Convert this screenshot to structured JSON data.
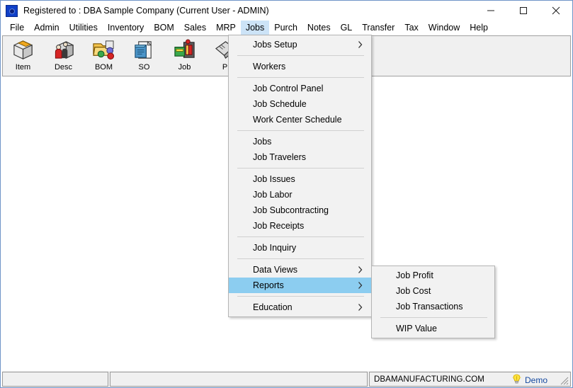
{
  "window": {
    "title": "Registered to : DBA Sample Company (Current User - ADMIN)",
    "icon": "app-gear-icon",
    "controls": {
      "minimize": "minimize-icon",
      "maximize": "maximize-icon",
      "close": "close-icon"
    }
  },
  "menubar": {
    "items": [
      {
        "label": "File",
        "active": false
      },
      {
        "label": "Admin",
        "active": false
      },
      {
        "label": "Utilities",
        "active": false
      },
      {
        "label": "Inventory",
        "active": false
      },
      {
        "label": "BOM",
        "active": false
      },
      {
        "label": "Sales",
        "active": false
      },
      {
        "label": "MRP",
        "active": false
      },
      {
        "label": "Jobs",
        "active": true
      },
      {
        "label": "Purch",
        "active": false
      },
      {
        "label": "Notes",
        "active": false
      },
      {
        "label": "GL",
        "active": false
      },
      {
        "label": "Transfer",
        "active": false
      },
      {
        "label": "Tax",
        "active": false
      },
      {
        "label": "Window",
        "active": false
      },
      {
        "label": "Help",
        "active": false
      }
    ]
  },
  "toolbar": {
    "buttons": [
      {
        "label": "Item",
        "icon": "item-box-icon"
      },
      {
        "label": "Desc",
        "icon": "descriptor-people-box-icon"
      },
      {
        "label": "BOM",
        "icon": "bom-folder-icon"
      },
      {
        "label": "SO",
        "icon": "sales-order-notepad-icon"
      },
      {
        "label": "Job",
        "icon": "job-machine-icon"
      },
      {
        "label": "P",
        "icon": "purchase-icon"
      }
    ]
  },
  "jobs_menu": {
    "name": "Jobs",
    "items": [
      {
        "label": "Jobs Setup",
        "submenu": true,
        "selected": false,
        "separator_after": true
      },
      {
        "label": "Workers",
        "submenu": false,
        "selected": false,
        "separator_after": true
      },
      {
        "label": "Job Control Panel",
        "submenu": false,
        "selected": false,
        "separator_after": false
      },
      {
        "label": "Job Schedule",
        "submenu": false,
        "selected": false,
        "separator_after": false
      },
      {
        "label": "Work Center Schedule",
        "submenu": false,
        "selected": false,
        "separator_after": true
      },
      {
        "label": "Jobs",
        "submenu": false,
        "selected": false,
        "separator_after": false
      },
      {
        "label": "Job Travelers",
        "submenu": false,
        "selected": false,
        "separator_after": true
      },
      {
        "label": "Job Issues",
        "submenu": false,
        "selected": false,
        "separator_after": false
      },
      {
        "label": "Job Labor",
        "submenu": false,
        "selected": false,
        "separator_after": false
      },
      {
        "label": "Job Subcontracting",
        "submenu": false,
        "selected": false,
        "separator_after": false
      },
      {
        "label": "Job Receipts",
        "submenu": false,
        "selected": false,
        "separator_after": true
      },
      {
        "label": "Job Inquiry",
        "submenu": false,
        "selected": false,
        "separator_after": true
      },
      {
        "label": "Data Views",
        "submenu": true,
        "selected": false,
        "separator_after": false
      },
      {
        "label": "Reports",
        "submenu": true,
        "selected": true,
        "separator_after": true
      },
      {
        "label": "Education",
        "submenu": true,
        "selected": false,
        "separator_after": false
      }
    ]
  },
  "reports_submenu": {
    "name": "Reports",
    "items": [
      {
        "label": "Job Profit",
        "submenu": false,
        "selected": false,
        "separator_after": false
      },
      {
        "label": "Job Cost",
        "submenu": false,
        "selected": false,
        "separator_after": false
      },
      {
        "label": "Job Transactions",
        "submenu": false,
        "selected": false,
        "separator_after": true
      },
      {
        "label": "WIP Value",
        "submenu": false,
        "selected": false,
        "separator_after": false
      }
    ]
  },
  "statusbar": {
    "panel1": "",
    "panel2": "",
    "panel3": "DBAMANUFACTURING.COM",
    "demo_label": "Demo",
    "demo_icon": "lightbulb-icon",
    "resize_grip": "resize-grip-icon"
  },
  "colors": {
    "menu_highlight": "#8ccdf0",
    "menubar_active": "#cce3f7",
    "toolbar_bg": "#f0f0f0",
    "menu_bg": "#f2f2f2",
    "demo_text": "#1549a0",
    "window_border": "#6f94c8"
  }
}
